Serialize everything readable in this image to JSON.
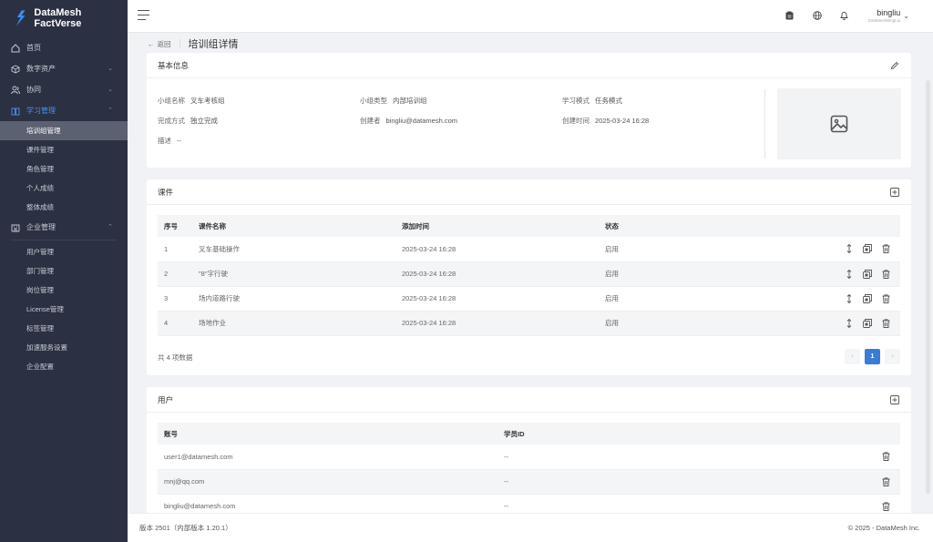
{
  "app": {
    "name": "DataMesh FactVerse"
  },
  "sidebar": {
    "items": [
      {
        "label": "首页"
      },
      {
        "label": "数字资产"
      },
      {
        "label": "协同"
      },
      {
        "label": "学习管理"
      },
      {
        "label": "企业管理"
      }
    ],
    "learning_sub": [
      {
        "label": "培训组管理"
      },
      {
        "label": "课件管理"
      },
      {
        "label": "角色管理"
      },
      {
        "label": "个人成绩"
      },
      {
        "label": "整体成绩"
      }
    ],
    "enterprise_sub": [
      {
        "label": "用户管理"
      },
      {
        "label": "部门管理"
      },
      {
        "label": "岗位管理"
      },
      {
        "label": "License管理"
      },
      {
        "label": "标签管理"
      },
      {
        "label": "加速服务设置"
      },
      {
        "label": "企业配置"
      }
    ]
  },
  "topbar": {
    "username": "bingliu",
    "org": "DataMeshBingLiu"
  },
  "page": {
    "back_label": "返回",
    "title": "培训组详情"
  },
  "basic": {
    "title": "基本信息",
    "fields": [
      {
        "key": "小组名称",
        "value": "叉车考核组"
      },
      {
        "key": "小组类型",
        "value": "内部培训组"
      },
      {
        "key": "学习模式",
        "value": "任务模式"
      },
      {
        "key": "完成方式",
        "value": "独立完成"
      },
      {
        "key": "创建者",
        "value": "bingliu@datamesh.com"
      },
      {
        "key": "创建时间",
        "value": "2025-03-24 16:28"
      },
      {
        "key": "描述",
        "value": "--"
      }
    ]
  },
  "courses": {
    "title": "课件",
    "headers": [
      "序号",
      "课件名称",
      "添加时间",
      "状态"
    ],
    "rows": [
      [
        "1",
        "叉车基础操作",
        "2025-03-24 16:28",
        "启用"
      ],
      [
        "2",
        "\"8\"字行驶",
        "2025-03-24 16:28",
        "启用"
      ],
      [
        "3",
        "场内道路行驶",
        "2025-03-24 16:28",
        "启用"
      ],
      [
        "4",
        "场地作业",
        "2025-03-24 16:28",
        "启用"
      ]
    ],
    "total": "共 4 项数据",
    "pager": {
      "prev": "‹",
      "current": "1",
      "next": "›"
    }
  },
  "users": {
    "title": "用户",
    "headers": [
      "账号",
      "学员ID"
    ],
    "rows": [
      [
        "user1@datamesh.com",
        "--"
      ],
      [
        "mnj@qq.com",
        "--"
      ],
      [
        "bingliu@datamesh.com",
        "--"
      ]
    ]
  },
  "footer": {
    "version": "版本 2501（内部版本 1.20.1）",
    "copyright": "© 2025 - DataMesh Inc."
  }
}
